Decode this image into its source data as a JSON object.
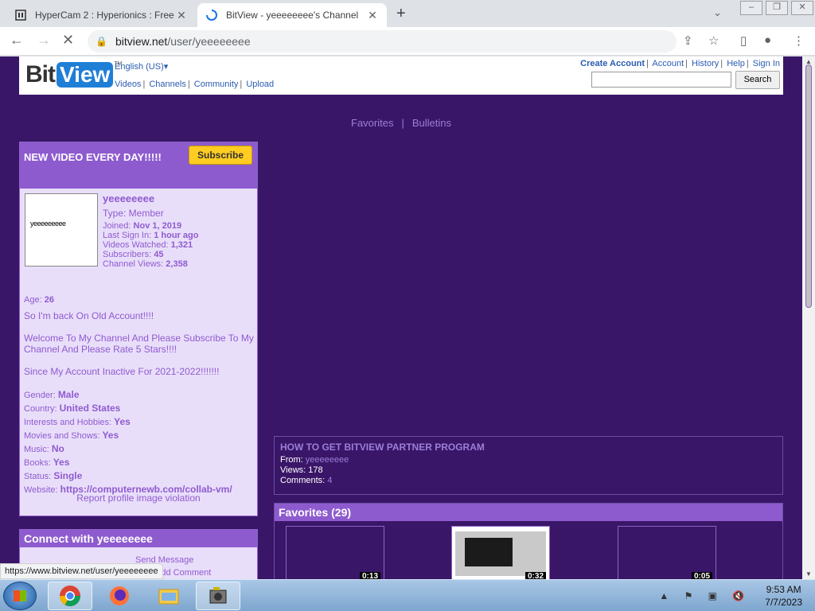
{
  "browser": {
    "tabs": [
      {
        "title": "HyperCam 2 : Hyperionics : Free Do",
        "active": false
      },
      {
        "title": "BitView - yeeeeeeee's Channel",
        "active": true
      }
    ],
    "new_tab": "+",
    "url_host": "bitview.net",
    "url_path": "/user/yeeeeeeee",
    "status_url": "https://www.bitview.net/user/yeeeeeeee"
  },
  "site": {
    "logo_bit": "Bit",
    "logo_view": "View",
    "logo_tm": "TM",
    "language": "English (US)",
    "nav": [
      "Videos",
      "Channels",
      "Community",
      "Upload"
    ],
    "account_links": [
      "Create Account",
      "Account",
      "History",
      "Help",
      "Sign In"
    ],
    "search_button": "Search",
    "search_value": ""
  },
  "channel_nav": [
    "Favorites",
    "Bulletins"
  ],
  "profile": {
    "title": "NEW VIDEO EVERY DAY!!!!!",
    "subscribe_label": "Subscribe",
    "avatar_text": "yeeeeeeeee",
    "username": "yeeeeeeee",
    "type": "Type: Member",
    "joined_label": "Joined:",
    "joined": "Nov 1, 2019",
    "last_sign_in_label": "Last Sign In:",
    "last_sign_in": "1 hour ago",
    "videos_watched_label": "Videos Watched:",
    "videos_watched": "1,321",
    "subscribers_label": "Subscribers:",
    "subscribers": "45",
    "channel_views_label": "Channel Views:",
    "channel_views": "2,358",
    "age_label": "Age:",
    "age": "26",
    "bio": [
      "So I'm back On Old Account!!!!",
      "Welcome To My Channel And Please Subscribe To My Channel And Please Rate 5 Stars!!!!",
      "Since My Account Inactive For 2021-2022!!!!!!!"
    ],
    "details": [
      {
        "label": "Gender:",
        "value": "Male"
      },
      {
        "label": "Country:",
        "value": "United States"
      },
      {
        "label": "Interests and Hobbies:",
        "value": "Yes"
      },
      {
        "label": "Movies and Shows:",
        "value": "Yes"
      },
      {
        "label": "Music:",
        "value": "No"
      },
      {
        "label": "Books:",
        "value": "Yes"
      },
      {
        "label": "Status:",
        "value": "Single"
      },
      {
        "label": "Website:",
        "value": "https://computernewb.com/collab-vm/"
      }
    ],
    "report_link": "Report profile image violation"
  },
  "connect": {
    "title": "Connect with yeeeeeeee",
    "send_message": "Send Message",
    "add_comment": "Add Comment"
  },
  "featured": {
    "title": "HOW TO GET BITVIEW PARTNER PROGRAM",
    "from_label": "From:",
    "from": "yeeeeeeee",
    "views_label": "Views:",
    "views": "178",
    "comments_label": "Comments:",
    "comments": "4"
  },
  "favorites": {
    "title": "Favorites (29)",
    "items": [
      {
        "duration": "0:13"
      },
      {
        "duration": "0:32"
      },
      {
        "duration": "0:05"
      }
    ]
  },
  "taskbar": {
    "time": "9:53 AM",
    "date": "7/7/2023",
    "apps": [
      "chrome-icon",
      "firefox-icon",
      "explorer-icon",
      "hypercam-icon"
    ]
  },
  "colors": {
    "page_bg": "#3a1668",
    "panel_header": "#8e5bcf",
    "panel_bg": "#e9defa",
    "link": "#9b7fd8",
    "subscribe": "#ffcc22"
  }
}
